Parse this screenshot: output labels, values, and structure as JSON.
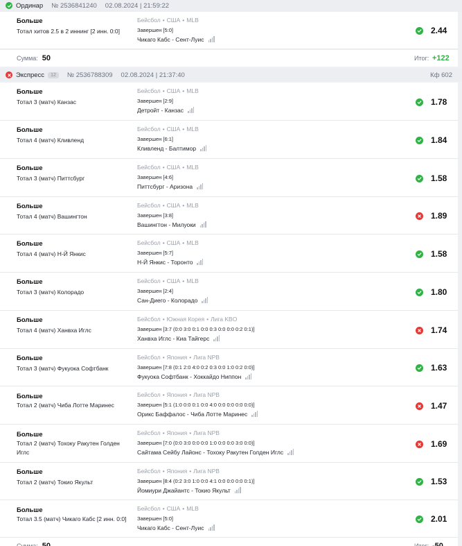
{
  "bet1": {
    "type": "Ординар",
    "status": "win",
    "number": "№ 2536841240",
    "date": "02.08.2024 | 21:59:22",
    "events": [
      {
        "title": "Больше",
        "market": "Тотал хитов 2.5 в 2 иннинг [2 инн. 0:0]",
        "sport": "Бейсбол",
        "country": "США",
        "league": "MLB",
        "finished": "Завершен [5:0]",
        "match": "Чикаго Кабс - Сент-Луис",
        "result": "win",
        "coef": "2.44"
      }
    ],
    "sum_label": "Сумма:",
    "sum_value": "50",
    "total_label": "Итог:",
    "total_value": "+122"
  },
  "bet2": {
    "type": "Экспресс",
    "status": "loss",
    "badge": "12",
    "number": "№ 2536788309",
    "date": "02.08.2024 | 21:37:40",
    "kf": "Кф 602",
    "events": [
      {
        "title": "Больше",
        "market": "Тотал 3 (матч) Канзас",
        "sport": "Бейсбол",
        "country": "США",
        "league": "MLB",
        "finished": "Завершен [2:9]",
        "match": "Детройт - Канзас",
        "result": "win",
        "coef": "1.78"
      },
      {
        "title": "Больше",
        "market": "Тотал 4 (матч) Кливленд",
        "sport": "Бейсбол",
        "country": "США",
        "league": "MLB",
        "finished": "Завершен [6:1]",
        "match": "Кливленд - Балтимор",
        "result": "win",
        "coef": "1.84"
      },
      {
        "title": "Больше",
        "market": "Тотал 3 (матч) Питтсбург",
        "sport": "Бейсбол",
        "country": "США",
        "league": "MLB",
        "finished": "Завершен [4:6]",
        "match": "Питтсбург - Аризона",
        "result": "win",
        "coef": "1.58"
      },
      {
        "title": "Больше",
        "market": "Тотал 4 (матч) Вашингтон",
        "sport": "Бейсбол",
        "country": "США",
        "league": "MLB",
        "finished": "Завершен [3:8]",
        "match": "Вашингтон - Милуоки",
        "result": "loss",
        "coef": "1.89"
      },
      {
        "title": "Больше",
        "market": "Тотал 4 (матч) Н-Й Янкис",
        "sport": "Бейсбол",
        "country": "США",
        "league": "MLB",
        "finished": "Завершен [5:7]",
        "match": "Н-Й Янкис - Торонто",
        "result": "win",
        "coef": "1.58"
      },
      {
        "title": "Больше",
        "market": "Тотал 3 (матч) Колорадо",
        "sport": "Бейсбол",
        "country": "США",
        "league": "MLB",
        "finished": "Завершен [2:4]",
        "match": "Сан-Диего - Колорадо",
        "result": "win",
        "coef": "1.80"
      },
      {
        "title": "Больше",
        "market": "Тотал 4 (матч) Ханвха Иглс",
        "sport": "Бейсбол",
        "country": "Южная Корея",
        "league": "Лига KBO",
        "finished": "Завершен [3:7 (0:0 3:0 0:1 0:0 0:3 0:0 0:0 0:2 0:1)]",
        "match": "Ханвха Иглс - Киа Тайгерс",
        "result": "loss",
        "coef": "1.74"
      },
      {
        "title": "Больше",
        "market": "Тотал 3 (матч) Фукуока Софтбанк",
        "sport": "Бейсбол",
        "country": "Япония",
        "league": "Лига NPB",
        "finished": "Завершен [7:8 (0:1 2:0 4:0 0:2 0:3 0:0 1:0 0:2 0:0)]",
        "match": "Фукуока Софтбанк - Хоккайдо Ниппон",
        "result": "win",
        "coef": "1.63"
      },
      {
        "title": "Больше",
        "market": "Тотал 2 (матч) Чиба Лотте Маринес",
        "sport": "Бейсбол",
        "country": "Япония",
        "league": "Лига NPB",
        "finished": "Завершен [5:1 (1:0 0:0 0:1 0:0 4:0 0:0 0:0 0:0 0:0)]",
        "match": "Орикс Баффалос - Чиба Лотте Маринес",
        "result": "loss",
        "coef": "1.47"
      },
      {
        "title": "Больше",
        "market": "Тотал 2 (матч) Тохоку Ракутен Голден Иглс",
        "sport": "Бейсбол",
        "country": "Япония",
        "league": "Лига NPB",
        "finished": "Завершен [7:0 (0:0 3:0 0:0 0:0 1:0 0:0 0:0 3:0 0:0)]",
        "match": "Сайтама Сейбу Лайонс - Тохоку Ракутен Голден Иглс",
        "result": "loss",
        "coef": "1.69"
      },
      {
        "title": "Больше",
        "market": "Тотал 2 (матч) Токио Якульт",
        "sport": "Бейсбол",
        "country": "Япония",
        "league": "Лига NPB",
        "finished": "Завершен [8:4 (0:2 3:0 1:0 0:0 4:1 0:0 0:0 0:0 0:1)]",
        "match": "Йомиури Джайантс - Токио Якульт",
        "result": "win",
        "coef": "1.53"
      },
      {
        "title": "Больше",
        "market": "Тотал 3.5 (матч) Чикаго Кабс [2 инн. 0:0]",
        "sport": "Бейсбол",
        "country": "США",
        "league": "MLB",
        "finished": "Завершен [5:0]",
        "match": "Чикаго Кабс - Сент-Луис",
        "result": "win",
        "coef": "2.01"
      }
    ],
    "sum_label": "Сумма:",
    "sum_value": "50",
    "total_label": "Итог:",
    "total_value": "-50"
  },
  "colors": {
    "win": "#2fb344",
    "loss": "#e53935",
    "muted": "#9aa0a8"
  },
  "icons": {
    "win": "check-circle-icon",
    "loss": "cross-circle-icon",
    "stats": "stats-bars-icon"
  }
}
